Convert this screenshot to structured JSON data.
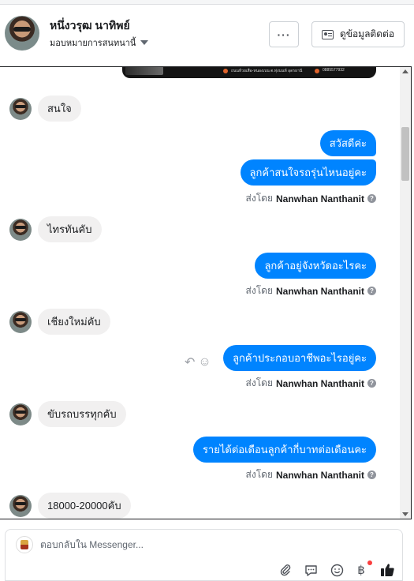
{
  "header": {
    "contact_name": "หนึ่งวรุฒ นาทิพย์",
    "assign_label": "มอบหมายการสนทนานี้",
    "more_label": "···",
    "contact_info_label": "ดูข้อมูลติดต่อ"
  },
  "banner": {
    "text_location": "ถนนห้วยเสือ-หนองเบน ต.ทุ่งนนท์ อุดรธานี",
    "phone": "0885577932"
  },
  "messages": {
    "in_1": "สนใจ",
    "out_1a": "สวัสดีค่ะ",
    "out_1b": "ลูกค้าสนใจรถรุ่นไหนอยู่คะ",
    "in_2": "ไทรทันคับ",
    "out_2": "ลูกค้าอยู่จังหวัดอะไรคะ",
    "in_3": "เชียงใหม่คับ",
    "out_3": "ลูกค้าประกอบอาชีพอะไรอยู่คะ",
    "in_4": "ขับรถบรรทุกคับ",
    "out_4": "รายได้ต่อเดือนลูกค้ากี่บาทต่อเดือนคะ",
    "in_5": "18000-20000คับ"
  },
  "sent_by": {
    "prefix": "ส่งโดย",
    "agent": "Nanwhan Nanthanit",
    "help": "?"
  },
  "composer": {
    "placeholder": "ตอบกลับใน Messenger..."
  },
  "colors": {
    "outgoing_bubble": "#0084ff",
    "incoming_bubble": "#f1f0f0",
    "like_icon": "#1c1e21"
  },
  "icons": {
    "attach": "paperclip-icon",
    "saved_replies": "chat-bubble-icon",
    "emoji": "smiley-icon",
    "payment": "baht-icon",
    "like": "thumbs-up-icon"
  }
}
